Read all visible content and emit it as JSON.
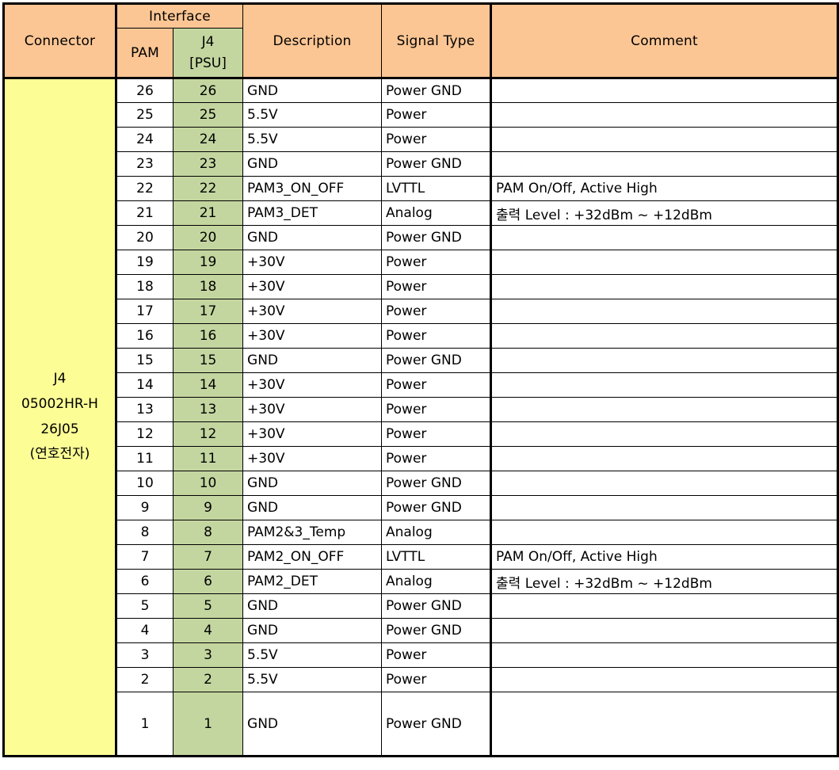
{
  "table": {
    "headers": {
      "connector": "Connector",
      "interface": "Interface",
      "pam": "PAM",
      "j4": "J4",
      "j4_psu": "[PSU]",
      "description": "Description",
      "signal_type": "Signal Type",
      "comment": "Comment"
    },
    "connector": {
      "line1": "J4",
      "line2": "05002HR-H",
      "line3": "26J05",
      "line4": "(연호전자)"
    },
    "colors": {
      "header_orange": "#fcc694",
      "j4_green": "#c4d6a0",
      "connector_yellow": "#fdfd96",
      "cell_white": "#ffffff",
      "border_black": "#000000",
      "light_comment_text": "#6f7b85"
    },
    "columns": [
      "PAM",
      "J4 [PSU]",
      "Description",
      "Signal Type",
      "Comment"
    ],
    "rows": [
      {
        "pam": "26",
        "j4": "26",
        "description": "GND",
        "signal": "Power GND",
        "comment": ""
      },
      {
        "pam": "25",
        "j4": "25",
        "description": "5.5V",
        "signal": "Power",
        "comment": ""
      },
      {
        "pam": "24",
        "j4": "24",
        "description": "5.5V",
        "signal": "Power",
        "comment": ""
      },
      {
        "pam": "23",
        "j4": "23",
        "description": "GND",
        "signal": "Power GND",
        "comment": ""
      },
      {
        "pam": "22",
        "j4": "22",
        "description": "PAM3_ON_OFF",
        "signal": "LVTTL",
        "comment": "PAM On/Off, Active High"
      },
      {
        "pam": "21",
        "j4": "21",
        "description": "PAM3_DET",
        "signal": "Analog",
        "comment": "출력 Level : +32dBm ~ +12dBm"
      },
      {
        "pam": "20",
        "j4": "20",
        "description": "GND",
        "signal": "Power GND",
        "comment": ""
      },
      {
        "pam": "19",
        "j4": "19",
        "description": "+30V",
        "signal": "Power",
        "comment": ""
      },
      {
        "pam": "18",
        "j4": "18",
        "description": "+30V",
        "signal": "Power",
        "comment": ""
      },
      {
        "pam": "17",
        "j4": "17",
        "description": "+30V",
        "signal": "Power",
        "comment": ""
      },
      {
        "pam": "16",
        "j4": "16",
        "description": "+30V",
        "signal": "Power",
        "comment": ""
      },
      {
        "pam": "15",
        "j4": "15",
        "description": "GND",
        "signal": "Power GND",
        "comment": ""
      },
      {
        "pam": "14",
        "j4": "14",
        "description": "+30V",
        "signal": "Power",
        "comment": ""
      },
      {
        "pam": "13",
        "j4": "13",
        "description": "+30V",
        "signal": "Power",
        "comment": ""
      },
      {
        "pam": "12",
        "j4": "12",
        "description": "+30V",
        "signal": "Power",
        "comment": ""
      },
      {
        "pam": "11",
        "j4": "11",
        "description": "+30V",
        "signal": "Power",
        "comment": ""
      },
      {
        "pam": "10",
        "j4": "10",
        "description": "GND",
        "signal": "Power GND",
        "comment": ""
      },
      {
        "pam": "9",
        "j4": "9",
        "description": "GND",
        "signal": "Power GND",
        "comment": ""
      },
      {
        "pam": "8",
        "j4": "8",
        "description": "PAM2&3_Temp",
        "signal": "Analog",
        "comment": ""
      },
      {
        "pam": "7",
        "j4": "7",
        "description": "PAM2_ON_OFF",
        "signal": "LVTTL",
        "comment": "PAM On/Off, Active High",
        "comment_style": "light"
      },
      {
        "pam": "6",
        "j4": "6",
        "description": "PAM2_DET",
        "signal": "Analog",
        "comment": "출력 Level : +32dBm ~ +12dBm",
        "comment_style": "light-dark"
      },
      {
        "pam": "5",
        "j4": "5",
        "description": "GND",
        "signal": "Power GND",
        "comment": ""
      },
      {
        "pam": "4",
        "j4": "4",
        "description": "GND",
        "signal": "Power GND",
        "comment": ""
      },
      {
        "pam": "3",
        "j4": "3",
        "description": "5.5V",
        "signal": "Power",
        "comment": ""
      },
      {
        "pam": "2",
        "j4": "2",
        "description": "5.5V",
        "signal": "Power",
        "comment": ""
      },
      {
        "pam": "1",
        "j4": "1",
        "description": "GND",
        "signal": "Power GND",
        "comment": "",
        "tall": true
      }
    ]
  }
}
